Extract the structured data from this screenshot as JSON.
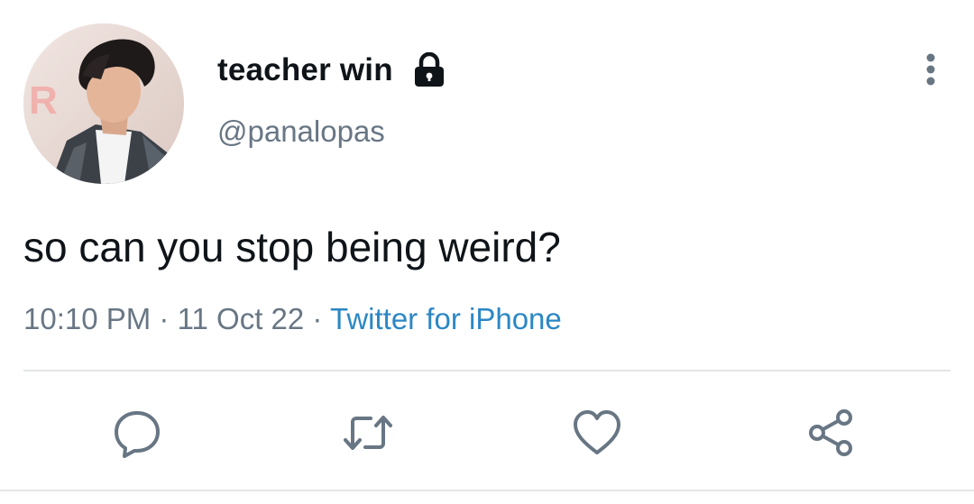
{
  "tweet": {
    "author": {
      "display_name": "teacher win",
      "handle": "@panalopas",
      "protected_icon": "lock-icon",
      "avatar": "profile-photo"
    },
    "menu_icon": "more-vertical-icon",
    "text": "so can you stop being weird?",
    "time": "10:10 PM",
    "separator": "·",
    "date": "11 Oct 22",
    "source": "Twitter for iPhone",
    "colors": {
      "text": "#0f1419",
      "secondary": "#687684",
      "link": "#2b87c5",
      "divider": "#e3e6e8",
      "icon": "#687684"
    },
    "actions": [
      {
        "icon": "reply-icon"
      },
      {
        "icon": "retweet-icon"
      },
      {
        "icon": "like-icon"
      },
      {
        "icon": "share-icon"
      }
    ]
  }
}
